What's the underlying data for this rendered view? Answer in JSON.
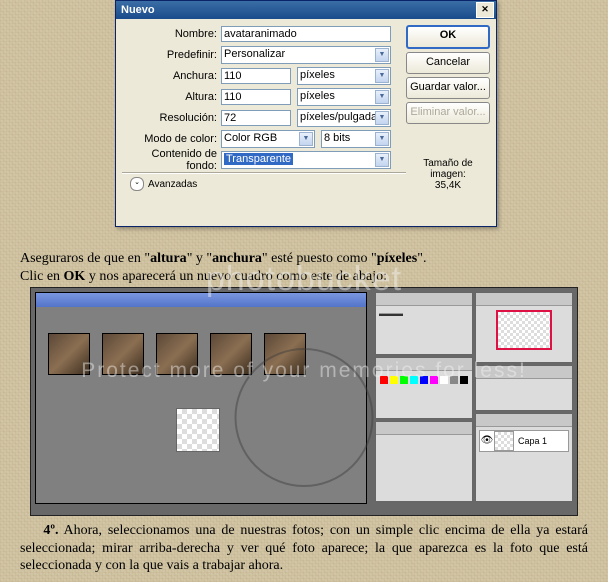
{
  "dialog": {
    "title": "Nuevo",
    "labels": {
      "nombre": "Nombre:",
      "predefinir": "Predefinir:",
      "anchura": "Anchura:",
      "altura": "Altura:",
      "resolucion": "Resolución:",
      "modo": "Modo de color:",
      "fondo": "Contenido de fondo:"
    },
    "values": {
      "nombre": "avataranimado",
      "predefinir": "Personalizar",
      "anchura": "110",
      "anchura_unit": "píxeles",
      "altura": "110",
      "altura_unit": "píxeles",
      "resolucion": "72",
      "resolucion_unit": "píxeles/pulgada",
      "modo": "Color RGB",
      "bits": "8 bits",
      "fondo": "Transparente"
    },
    "buttons": {
      "ok": "OK",
      "cancelar": "Cancelar",
      "guardar": "Guardar valor...",
      "eliminar": "Eliminar valor..."
    },
    "size_label": "Tamaño de imagen:",
    "size_value": "35,4K",
    "avanzadas": "Avanzadas"
  },
  "para1": {
    "line1a": "Aseguraros de que en \"",
    "line1b": "altura",
    "line1c": "\" y \"",
    "line1d": "anchura",
    "line1e": "\" esté puesto como \"",
    "line1f": "píxeles",
    "line1g": "\".",
    "line2a": "Clic en ",
    "line2b": "OK",
    "line2c": " y nos aparecerá un nuevo cuadro como este de abajo:"
  },
  "watermark": {
    "line1": "photobucket",
    "line2": "Protect more of your memories for less!"
  },
  "ps": {
    "layer1": "Capa 1"
  },
  "para2": {
    "num": "4º.",
    "text": " Ahora, seleccionamos una de nuestras fotos; con un simple clic encima de ella ya estará seleccionada; mirar arriba-derecha y ver qué foto aparece; la que aparezca es la foto que está seleccionada y con la que vais a trabajar ahora."
  }
}
